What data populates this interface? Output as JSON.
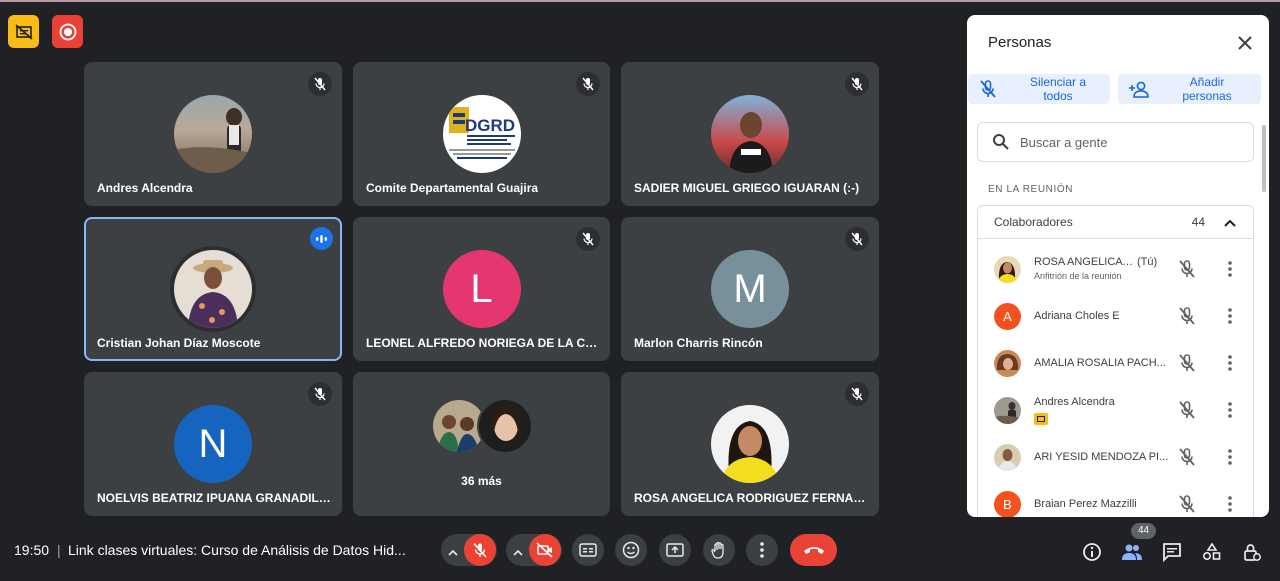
{
  "colors": {
    "background": "#202124",
    "tile": "#3c4043",
    "accent": "#8ab4f8",
    "panel": "#ffffff",
    "danger": "#ea4335",
    "primary_blue": "#1a73e8"
  },
  "corner_icons": [
    "presentation-off-icon",
    "record-icon"
  ],
  "tiles": [
    {
      "name": "Andres Alcendra",
      "avatar": "photo",
      "muted": true
    },
    {
      "name": "Comite Departamental Guajira",
      "avatar": "logo",
      "logo_text": "DGRD",
      "muted": true
    },
    {
      "name": "SADIER MIGUEL GRIEGO IGUARAN (:-)",
      "avatar": "photo",
      "muted": true
    },
    {
      "name": "Cristian Johan Díaz Moscote",
      "avatar": "photo",
      "muted": false,
      "speaking": true
    },
    {
      "name": "LEONEL ALFREDO NORIEGA DE LA CRUZ",
      "avatar": "letter",
      "letter": "L",
      "avatar_color": "#e5376f",
      "muted": true
    },
    {
      "name": "Marlon Charris Rincón",
      "avatar": "letter",
      "letter": "M",
      "avatar_color": "#78909c",
      "muted": true
    },
    {
      "name": "NOELVIS BEATRIZ IPUANA GRANADILL...",
      "avatar": "letter",
      "letter": "N",
      "avatar_color": "#1565c0",
      "muted": true
    },
    {
      "name": "36 más",
      "avatar": "group",
      "muted": false
    },
    {
      "name": "ROSA ANGELICA RODRIGUEZ FERNAN...",
      "avatar": "photo",
      "muted": true
    }
  ],
  "panel": {
    "title": "Personas",
    "mute_all_label": "Silenciar a todos",
    "add_people_label": "Añadir personas",
    "search_placeholder": "Buscar a gente",
    "section_label": "EN LA REUNIÓN",
    "group_label": "Colaboradores",
    "group_count": "44",
    "participants": [
      {
        "name": "ROSA ANGELICA R...",
        "suffix": "(Tú)",
        "subtitle": "Anfitrión de la reunión",
        "avatar": "photo"
      },
      {
        "name": "Adriana Choles E",
        "avatar": "letter",
        "letter": "A",
        "avatar_color": "#f4511e"
      },
      {
        "name": "AMALIA ROSALIA PACH...",
        "avatar": "photo"
      },
      {
        "name": "Andres Alcendra",
        "avatar": "photo",
        "presenting_badge": true
      },
      {
        "name": "ARI YESID MENDOZA PI...",
        "avatar": "photo"
      },
      {
        "name": "Braian Perez Mazzilli",
        "avatar": "letter",
        "letter": "B",
        "avatar_color": "#f4511e"
      }
    ]
  },
  "bottom_bar": {
    "time": "19:50",
    "separator": "|",
    "meeting_title": "Link clases virtuales: Curso de Análisis de Datos Hid...",
    "participants_badge": "44"
  }
}
